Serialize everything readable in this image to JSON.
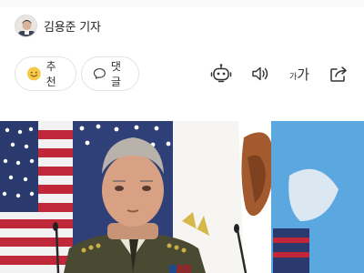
{
  "byline": {
    "reporter": "김용준 기자",
    "avatar_icon": "reporter-avatar"
  },
  "actions": {
    "recommend": {
      "label": "추천",
      "icon": "smile-emoji-icon"
    },
    "comment": {
      "label": "댓글",
      "icon": "speech-bubble-icon"
    },
    "tools": [
      {
        "name": "robot-summary-icon"
      },
      {
        "name": "speaker-icon"
      },
      {
        "name": "font-size-icon",
        "small": "가",
        "big": "가"
      },
      {
        "name": "share-icon"
      }
    ]
  },
  "photo": {
    "subject": "article-photo"
  },
  "colors": {
    "emoji": "#f7c948",
    "border": "#e3e3e3",
    "text": "#222222",
    "flag_blue": "#2b3a6e",
    "flag_red": "#c0283a",
    "flag_light_blue": "#5ba7e0"
  }
}
